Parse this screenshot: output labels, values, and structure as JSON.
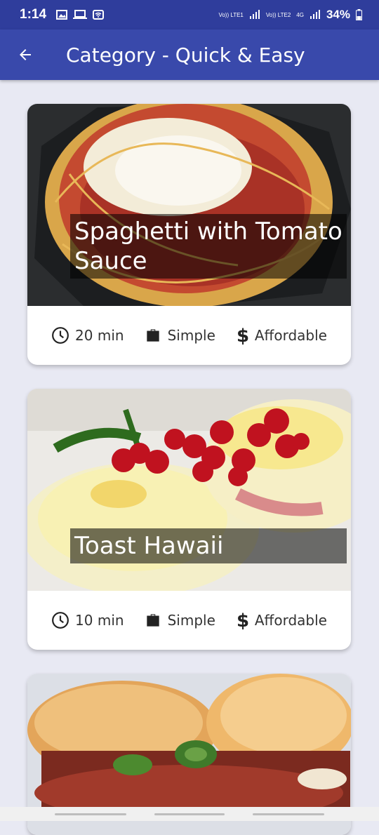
{
  "status_bar": {
    "time": "1:14",
    "battery": "34%",
    "net1": "Vo)) LTE1",
    "net2": "Vo)) LTE2",
    "net3": "4G"
  },
  "app_bar": {
    "title": "Category - Quick & Easy"
  },
  "meals": [
    {
      "title": "Spaghetti with Tomato Sauce",
      "duration": "20 min",
      "complexity": "Simple",
      "affordability": "Affordable"
    },
    {
      "title": "Toast Hawaii",
      "duration": "10 min",
      "complexity": "Simple",
      "affordability": "Affordable"
    }
  ],
  "colors": {
    "status_bar": "#2f3d9c",
    "app_bar": "#3949ab",
    "background": "#e8e9f3"
  }
}
